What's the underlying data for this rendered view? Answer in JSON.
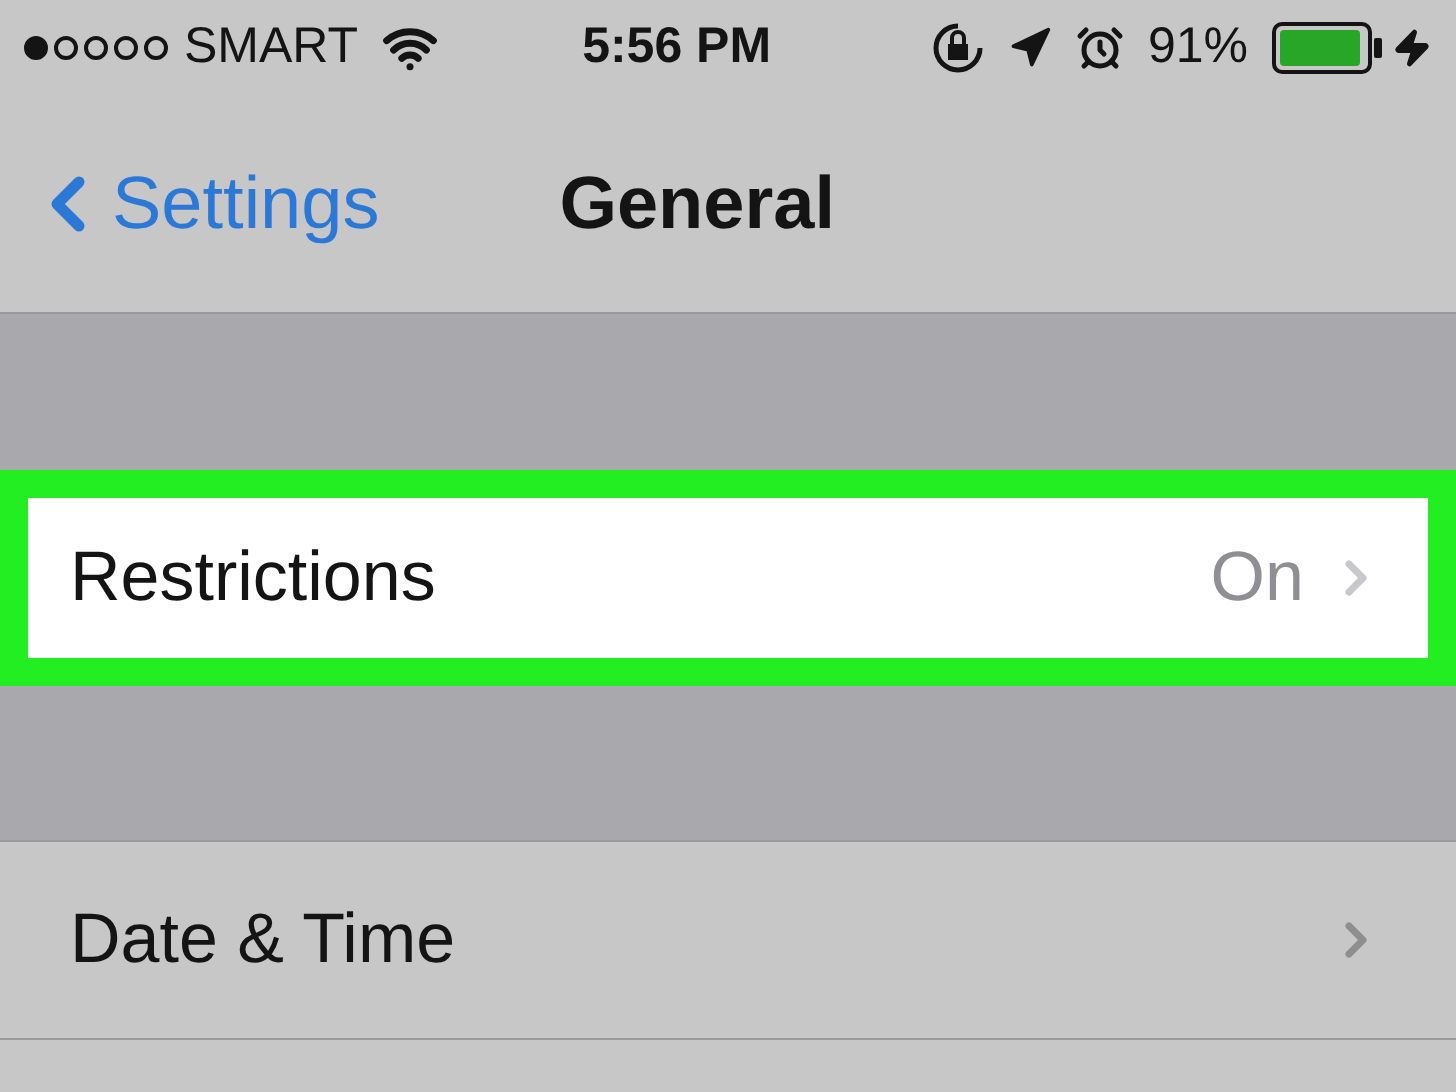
{
  "status_bar": {
    "carrier": "SMART",
    "time": "5:56 PM",
    "battery": "91%"
  },
  "nav": {
    "back": "Settings",
    "title": "General"
  },
  "rows": [
    {
      "label": "Restrictions",
      "value": "On",
      "highlighted": true
    },
    {
      "label": "Date & Time",
      "highlighted": false
    }
  ]
}
